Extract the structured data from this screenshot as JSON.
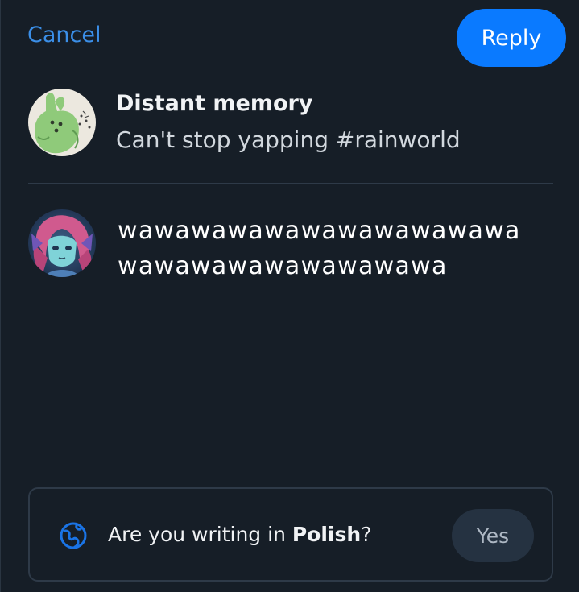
{
  "header": {
    "cancel_label": "Cancel",
    "reply_label": "Reply"
  },
  "parent_post": {
    "author": "Distant memory",
    "text": "Can't stop yapping #rainworld"
  },
  "composer": {
    "draft_text": "wawawawawawawawawawawawawawawawawawawawa"
  },
  "language_prompt": {
    "prefix": "Are you writing in ",
    "language": "Polish",
    "suffix": "?",
    "yes_label": "Yes"
  },
  "colors": {
    "background": "#161e27",
    "accent": "#0a7aff",
    "link": "#3b8fe8"
  }
}
